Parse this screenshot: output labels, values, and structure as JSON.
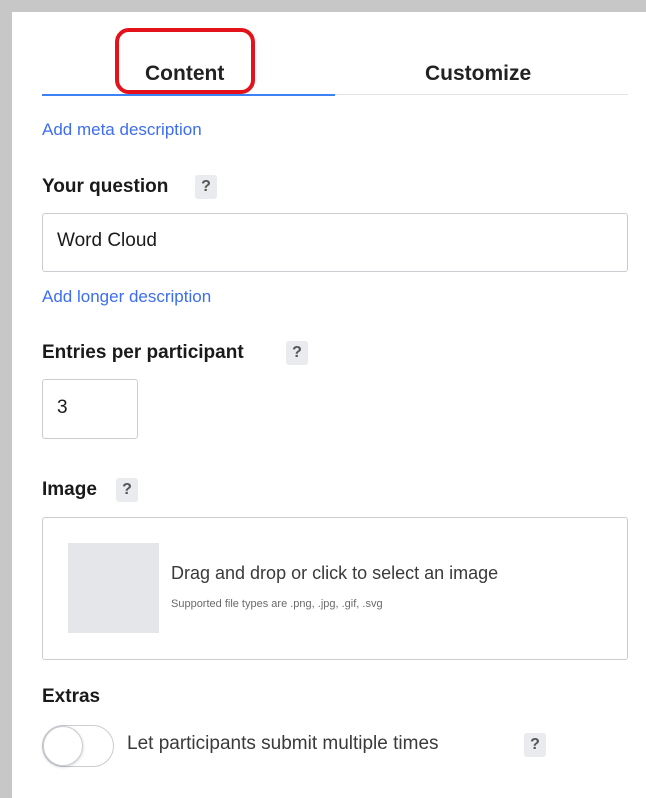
{
  "tabs": {
    "content_label": "Content",
    "customize_label": "Customize",
    "active": "Content"
  },
  "links": {
    "meta_description": "Add meta description",
    "longer_description": "Add longer description"
  },
  "question": {
    "label": "Your question",
    "help": "?",
    "value": "Word Cloud"
  },
  "entries": {
    "label": "Entries per participant",
    "help": "?",
    "value": "3"
  },
  "image": {
    "label": "Image",
    "help": "?",
    "drop_text": "Drag and drop or click to select an image",
    "supported_text": "Supported file types are .png, .jpg, .gif, .svg"
  },
  "extras": {
    "label": "Extras",
    "toggle_label": "Let participants submit multiple times",
    "toggle_on": false,
    "help": "?"
  },
  "colors": {
    "accent": "#3d82f4",
    "link": "#3d6ef2",
    "highlight": "#e3121b"
  }
}
